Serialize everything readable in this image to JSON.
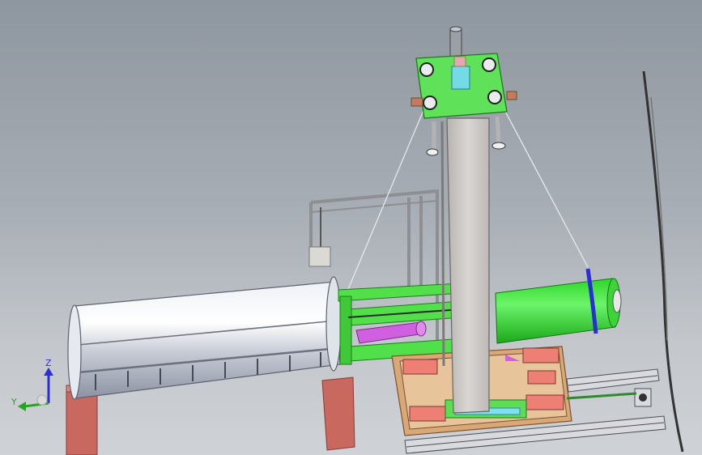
{
  "viewport": {
    "triad": {
      "z_label": "Z",
      "y_label": "Y"
    },
    "colors": {
      "background_top": "#8e969f",
      "background_bottom": "#cfd2d6",
      "steel": "#c9ced6",
      "green_part": "#52e04a",
      "magenta_part": "#d060e0",
      "brick_support": "#c8685e",
      "wood_frame": "#d9a877",
      "blue_band": "#2b2ed8"
    },
    "components": [
      "rotating-drum",
      "brick-support-left",
      "brick-support-right",
      "vertical-column",
      "top-plate",
      "green-cylinder",
      "green-arm-assembly",
      "magenta-drive",
      "rear-frame",
      "hanging-block",
      "wood-base-frame",
      "linear-rail-upper",
      "linear-rail-lower",
      "tension-cables",
      "right-edge-fragment"
    ]
  }
}
